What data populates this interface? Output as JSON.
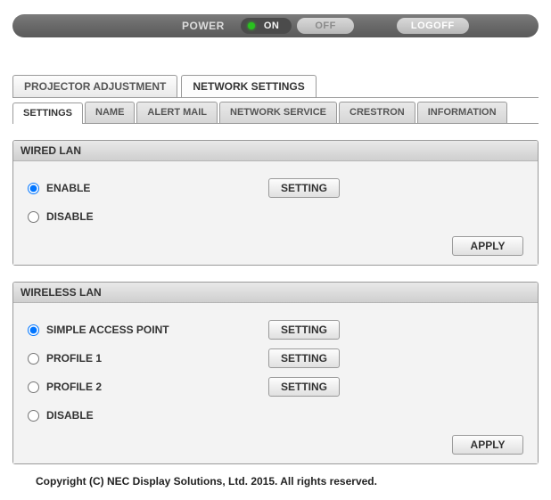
{
  "top_bar": {
    "power_label": "POWER",
    "on_label": "ON",
    "off_label": "OFF",
    "logoff_label": "LOGOFF"
  },
  "main_tabs": [
    {
      "label": "PROJECTOR ADJUSTMENT",
      "active": false
    },
    {
      "label": "NETWORK SETTINGS",
      "active": true
    }
  ],
  "sub_tabs": [
    {
      "label": "SETTINGS",
      "active": true
    },
    {
      "label": "NAME",
      "active": false
    },
    {
      "label": "ALERT MAIL",
      "active": false
    },
    {
      "label": "NETWORK SERVICE",
      "active": false
    },
    {
      "label": "CRESTRON",
      "active": false
    },
    {
      "label": "INFORMATION",
      "active": false
    }
  ],
  "wired_lan": {
    "title": "WIRED LAN",
    "options": [
      {
        "label": "ENABLE",
        "checked": true
      },
      {
        "label": "DISABLE",
        "checked": false
      }
    ],
    "setting_button": "SETTING",
    "apply_button": "APPLY"
  },
  "wireless_lan": {
    "title": "WIRELESS LAN",
    "options": [
      {
        "label": "SIMPLE ACCESS POINT",
        "checked": true,
        "has_setting": true
      },
      {
        "label": "PROFILE 1",
        "checked": false,
        "has_setting": true
      },
      {
        "label": "PROFILE 2",
        "checked": false,
        "has_setting": true
      },
      {
        "label": "DISABLE",
        "checked": false,
        "has_setting": false
      }
    ],
    "setting_button": "SETTING",
    "apply_button": "APPLY"
  },
  "footer": "Copyright (C) NEC Display Solutions, Ltd. 2015. All rights reserved."
}
